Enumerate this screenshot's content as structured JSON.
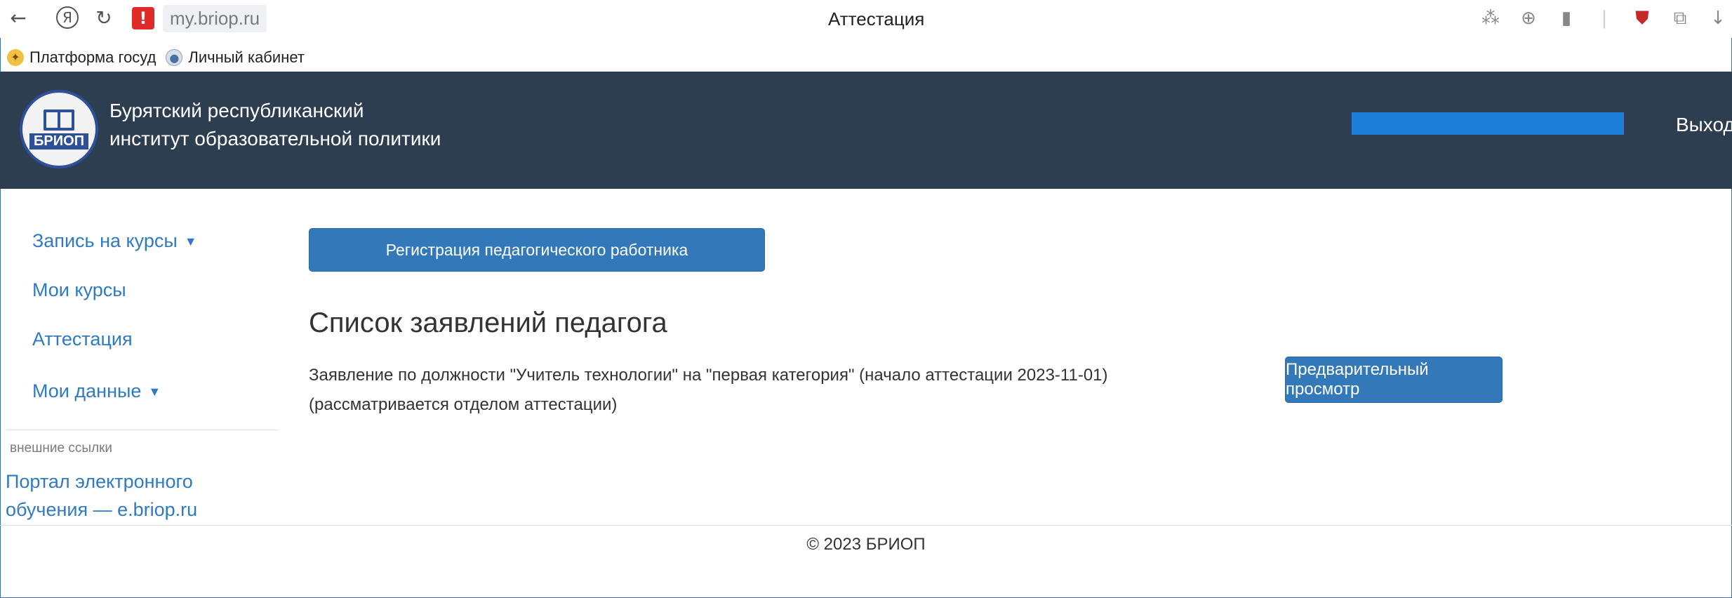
{
  "browser": {
    "back_icon": "←",
    "yandex_icon": "Я",
    "reload_icon": "↻",
    "warning_icon": "!",
    "url": "my.briop.ru",
    "tab_title": "Аттестация",
    "tool_icons": [
      "translate-icon",
      "zoom-icon",
      "bookmark-icon",
      "shield-icon",
      "extension-icon",
      "download-icon"
    ]
  },
  "bookmarks": [
    {
      "label": "Платформа госуд"
    },
    {
      "label": "Личный кабинет"
    }
  ],
  "header": {
    "logo_text": "БРИОП",
    "site_name_line1": "Бурятский республиканский",
    "site_name_line2": "институт образовательной политики",
    "logout": "Выход",
    "user_bar_color": "#1f7ed8",
    "bg_color": "#2c3e50"
  },
  "sidebar": {
    "items": [
      {
        "label": "Запись на курсы",
        "dropdown": true
      },
      {
        "label": "Мои курсы",
        "dropdown": false
      },
      {
        "label": "Аттестация",
        "dropdown": false
      },
      {
        "label": "Мои данные",
        "dropdown": true
      }
    ],
    "external_header": "внешние ссылки",
    "external_link": "Портал электронного обучения — e.briop.ru"
  },
  "main": {
    "register_button": "Регистрация педагогического работника",
    "heading": "Список заявлений педагога",
    "application_text": "Заявление по должности \"Учитель технологии\" на \"первая категория\" (начало аттестации 2023-11-01) (рассматривается отделом аттестации)",
    "preview_button": "Предварительный просмотр",
    "accent_color": "#3378b8",
    "link_color": "#2f7ac2"
  },
  "footer": {
    "text": "© 2023 БРИОП"
  }
}
